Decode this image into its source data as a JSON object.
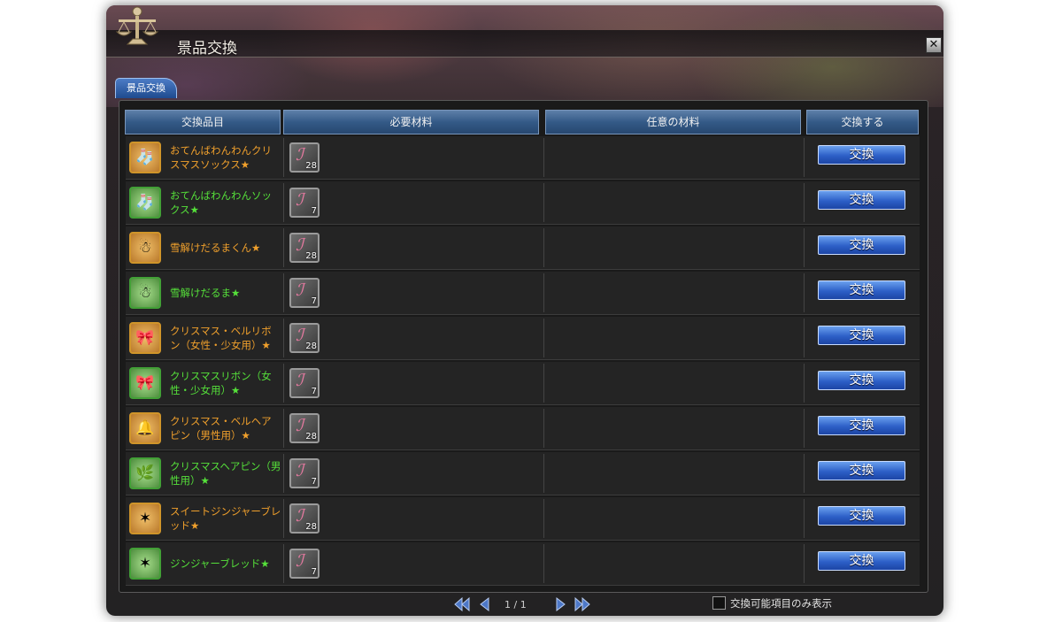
{
  "window": {
    "title": "景品交換",
    "close_symbol": "✕"
  },
  "tab": {
    "label": "景品交換"
  },
  "columns": {
    "item": "交換品目",
    "required": "必要材料",
    "optional": "任意の材料",
    "action": "交換する"
  },
  "rows": [
    {
      "name": "おてんばわんわんクリスマスソックス★",
      "color": "orange",
      "icon": "sock-icon",
      "glyph": "🧦",
      "material_count": "28",
      "button": "交換"
    },
    {
      "name": "おてんばわんわんソックス★",
      "color": "green",
      "icon": "sock-icon",
      "glyph": "🧦",
      "material_count": "7",
      "button": "交換"
    },
    {
      "name": "雪解けだるまくん★",
      "color": "orange",
      "icon": "snowman-icon",
      "glyph": "☃",
      "material_count": "28",
      "button": "交換"
    },
    {
      "name": "雪解けだるま★",
      "color": "green",
      "icon": "snowman-icon",
      "glyph": "☃",
      "material_count": "7",
      "button": "交換"
    },
    {
      "name": "クリスマス・ベルリボン（女性・少女用）★",
      "color": "orange",
      "icon": "bell-ribbon-icon",
      "glyph": "🎀",
      "material_count": "28",
      "button": "交換"
    },
    {
      "name": "クリスマスリボン（女性・少女用）★",
      "color": "green",
      "icon": "ribbon-icon",
      "glyph": "🎀",
      "material_count": "7",
      "button": "交換"
    },
    {
      "name": "クリスマス・ベルヘアピン（男性用）★",
      "color": "orange",
      "icon": "hairpin-icon",
      "glyph": "🔔",
      "material_count": "28",
      "button": "交換"
    },
    {
      "name": "クリスマスヘアピン（男性用）★",
      "color": "green",
      "icon": "hairpin-icon",
      "glyph": "🌿",
      "material_count": "7",
      "button": "交換"
    },
    {
      "name": "スイートジンジャーブレッド★",
      "color": "orange",
      "icon": "gingerbread-icon",
      "glyph": "✶",
      "material_count": "28",
      "button": "交換"
    },
    {
      "name": "ジンジャーブレッド★",
      "color": "green",
      "icon": "gingerbread-icon",
      "glyph": "✶",
      "material_count": "7",
      "button": "交換"
    }
  ],
  "material": {
    "icon": "material-token-icon",
    "glyph": "ℐ"
  },
  "pagination": {
    "page_text": "1 / 1"
  },
  "filter": {
    "label": "交換可能項目のみ表示",
    "checked": false
  },
  "colors": {
    "orange_text": "#f0a02c",
    "green_text": "#55e03a",
    "button_blue": "#2d5fc7"
  }
}
